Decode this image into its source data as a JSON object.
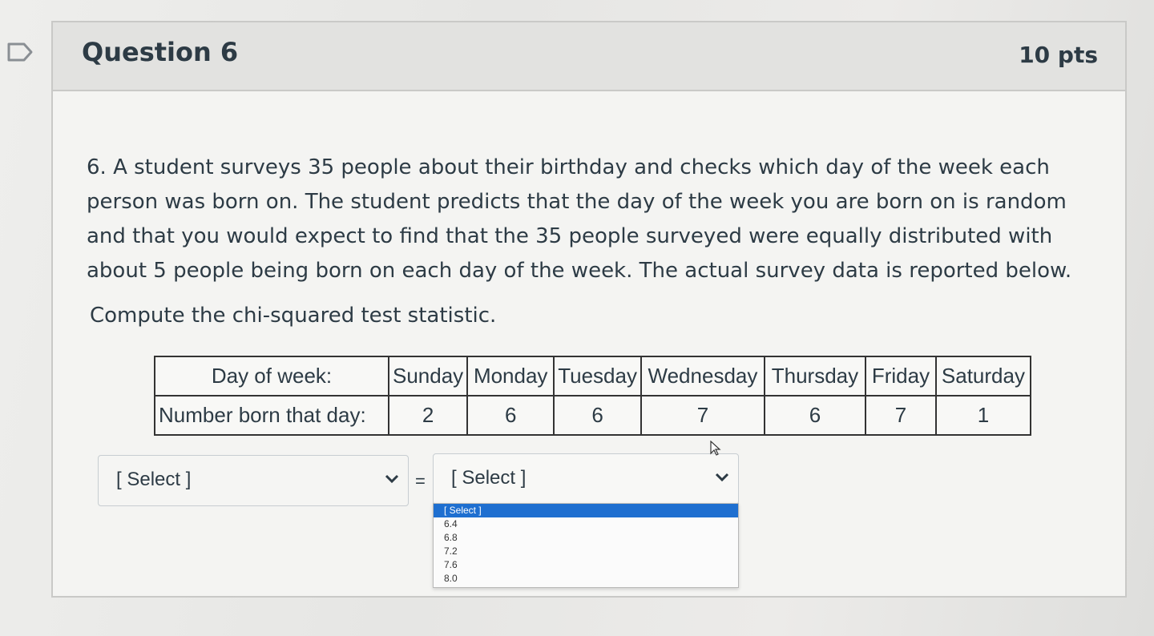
{
  "question": {
    "title": "Question 6",
    "points": "10 pts",
    "prompt": "6. A student surveys 35 people about their birthday and checks which day of the week each person was born on. The student predicts that the day of the week you are born on is random and that you would expect to find that the 35 people surveyed were equally distributed with about 5 people being born on each day of the week. The actual survey data is reported below.",
    "instruction": "Compute the chi-squared test statistic."
  },
  "table": {
    "header": [
      "Day of week:",
      "Sunday",
      "Monday",
      "Tuesday",
      "Wednesday",
      "Thursday",
      "Friday",
      "Saturday"
    ],
    "row": [
      "Number born that day:",
      "2",
      "6",
      "6",
      "7",
      "6",
      "7",
      "1"
    ]
  },
  "answer": {
    "left_select": "[ Select ]",
    "equals": "=",
    "right_select": "[ Select ]"
  },
  "dropdown": {
    "options": [
      "[ Select ]",
      "6.4",
      "6.8",
      "7.2",
      "7.6",
      "8.0"
    ],
    "selected_index": 0,
    "highlight_color": "#1e6fd0"
  },
  "icons": {
    "flag": "flag-icon",
    "chevron": "chevron-down-icon",
    "cursor": "cursor-icon"
  }
}
